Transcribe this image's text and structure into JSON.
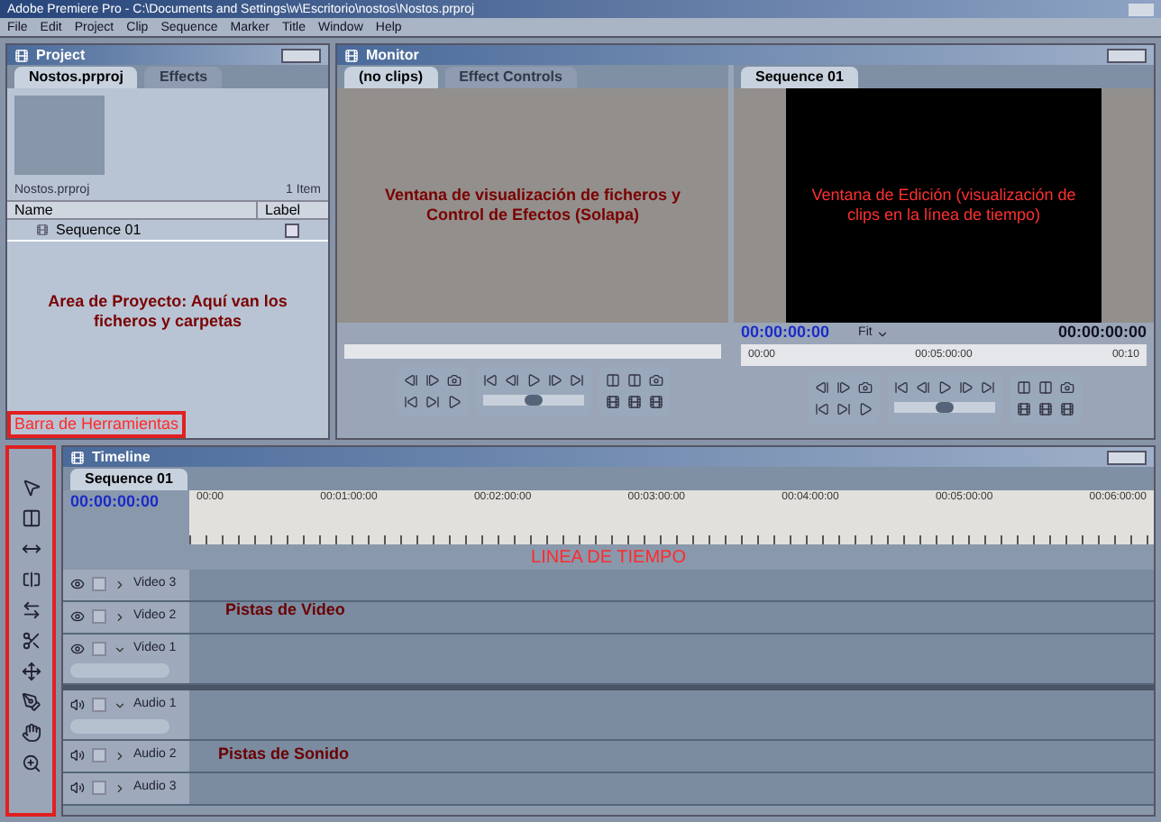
{
  "window": {
    "title": "Adobe Premiere Pro - C:\\Documents and Settings\\w\\Escritorio\\nostos\\Nostos.prproj"
  },
  "menu": [
    "File",
    "Edit",
    "Project",
    "Clip",
    "Sequence",
    "Marker",
    "Title",
    "Window",
    "Help"
  ],
  "project": {
    "title": "Project",
    "tabs": [
      {
        "label": "Nostos.prproj",
        "selected": true
      },
      {
        "label": "Effects",
        "selected": false
      }
    ],
    "file_name": "Nostos.prproj",
    "item_count": "1 Item",
    "columns": [
      "Name",
      "Label"
    ],
    "rows": [
      {
        "name": "Sequence 01",
        "checked": false
      }
    ],
    "note": "Area de Proyecto: Aquí van los ficheros y carpetas",
    "tools_note": "Barra de Herramientas"
  },
  "monitor": {
    "title": "Monitor",
    "source": {
      "tabs": [
        {
          "label": "(no clips)",
          "selected": true
        },
        {
          "label": "Effect Controls",
          "selected": false
        }
      ],
      "note": "Ventana de visualización de ficheros y Control de Efectos (Solapa)",
      "shuttle": {
        "level": 0.5
      }
    },
    "program": {
      "tabs": [
        {
          "label": "Sequence 01",
          "selected": true
        }
      ],
      "note": "Ventana de Edición (visualización de clips en la línea de tiempo)",
      "timecode": "00:00:00:00",
      "zoom": "Fit",
      "duration": "00:00:00:00",
      "shuttle": {
        "level": 0.5
      },
      "ruler": [
        "00:00",
        "00:05:00:00",
        "00:10"
      ]
    }
  },
  "timeline": {
    "title": "Timeline",
    "tabs": [
      {
        "label": "Sequence 01",
        "selected": true
      }
    ],
    "timecode": "00:00:00:00",
    "ruler": [
      "00:00",
      "00:01:00:00",
      "00:02:00:00",
      "00:03:00:00",
      "00:04:00:00",
      "00:05:00:00",
      "00:06:00:00"
    ],
    "note": "LINEA DE TIEMPO",
    "video_tracks": [
      {
        "name": "Video 3",
        "expanded": false
      },
      {
        "name": "Video 2",
        "expanded": false
      },
      {
        "name": "Video 1",
        "expanded": true
      }
    ],
    "audio_tracks": [
      {
        "name": "Audio 1",
        "expanded": true
      },
      {
        "name": "Audio 2",
        "expanded": false
      },
      {
        "name": "Audio 3",
        "expanded": false
      }
    ],
    "video_note": "Pistas de Video",
    "audio_note": "Pistas de Sonido"
  }
}
